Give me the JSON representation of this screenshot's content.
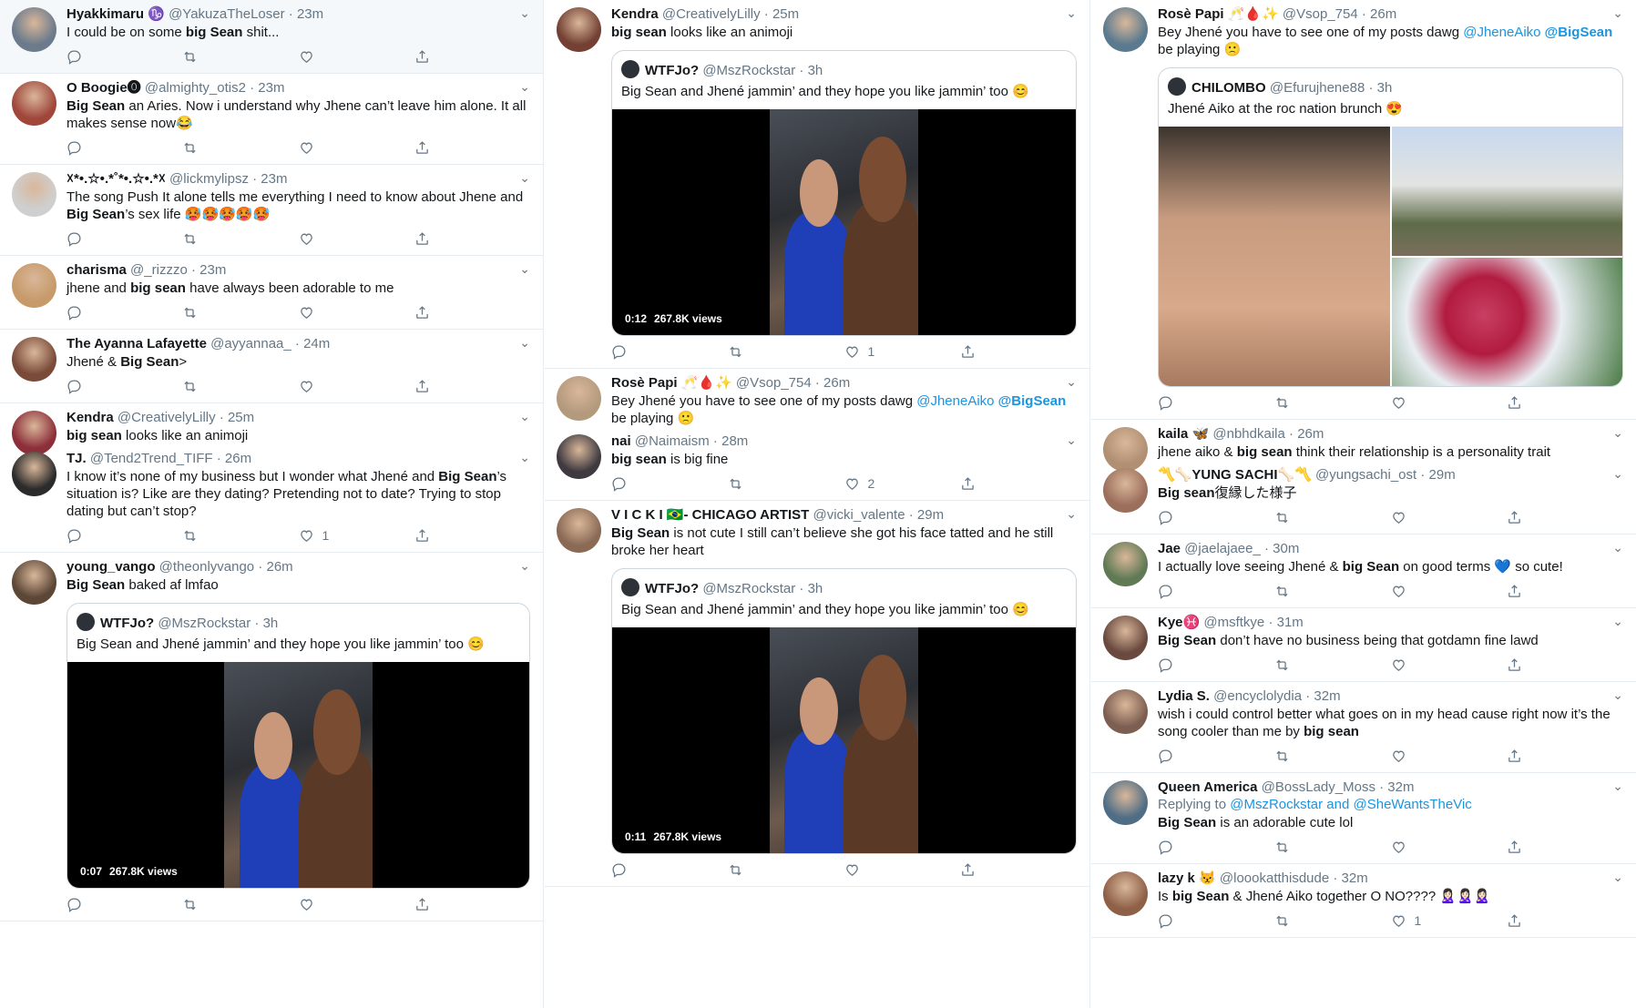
{
  "col1": [
    {
      "name": "Hyakkimaru ♑",
      "handle": "@YakuzaTheLoser",
      "time": "23m",
      "text": [
        [
          "I could be on some ",
          false
        ],
        [
          "big Sean",
          true
        ],
        [
          " shit...",
          false
        ]
      ],
      "likes": ""
    },
    {
      "name": "O Boogie⓿",
      "handle": "@almighty_otis2",
      "time": "23m",
      "text": [
        [
          "Big Sean",
          true
        ],
        [
          " an Aries. Now i understand why Jhene can’t leave him alone. It all makes sense now😂",
          false
        ]
      ],
      "likes": ""
    },
    {
      "name": "☓*•.☆•.*˚*•.☆•.*☓",
      "handle": "@lickmylipsz",
      "time": "23m",
      "text": [
        [
          "The song Push It alone tells me everything I need to know about Jhene and ",
          false
        ],
        [
          "Big Sean",
          true
        ],
        [
          "’s sex life 🥵🥵🥵🥵🥵",
          false
        ]
      ],
      "likes": ""
    },
    {
      "name": "charisma",
      "handle": "@_rizzzo",
      "time": "23m",
      "text": [
        [
          "jhene and ",
          false
        ],
        [
          "big sean",
          true
        ],
        [
          " have always been adorable to me",
          false
        ]
      ],
      "likes": ""
    },
    {
      "name": "The Ayanna Lafayette",
      "handle": "@ayyannaa_",
      "time": "24m",
      "text": [
        [
          "Jhené & ",
          false
        ],
        [
          "Big Sean",
          true
        ],
        [
          ">",
          false
        ]
      ],
      "likes": ""
    },
    {
      "name": "Kendra",
      "handle": "@CreativelyLilly",
      "time": "25m",
      "text": [
        [
          "big sean",
          true
        ],
        [
          " looks like an animoji",
          false
        ]
      ],
      "likes": "",
      "compact": true
    },
    {
      "name": "TJ.",
      "handle": "@Tend2Trend_TIFF",
      "time": "26m",
      "text": [
        [
          "I know it’s none of my business but I wonder what Jhené and ",
          false
        ],
        [
          "Big Sean",
          true
        ],
        [
          "’s situation is? Like are they dating? Pretending not to date? Trying to stop dating but can’t stop?",
          false
        ]
      ],
      "likes": "1"
    },
    {
      "name": "young_vango",
      "handle": "@theonlyvango",
      "time": "26m",
      "text": [
        [
          "Big Sean",
          true
        ],
        [
          " baked af lmfao",
          false
        ]
      ],
      "likes": "",
      "quote": {
        "name": "WTFJo?",
        "handle": "@MszRockstar",
        "time": "3h",
        "text": "Big Sean and Jhené jammin’ and they hope you like jammin’ too 😊",
        "video": {
          "time": "0:07",
          "views": "267.8K views"
        }
      }
    }
  ],
  "col2": [
    {
      "name": "Kendra",
      "handle": "@CreativelyLilly",
      "time": "25m",
      "text": [
        [
          "big sean",
          true
        ],
        [
          " looks like an animoji",
          false
        ]
      ],
      "likes": "1",
      "quote": {
        "name": "WTFJo?",
        "handle": "@MszRockstar",
        "time": "3h",
        "text": "Big Sean and Jhené jammin’ and they hope you like jammin’ too 😊",
        "video": {
          "time": "0:12",
          "views": "267.8K views"
        }
      }
    },
    {
      "name": "Rosè Papi 🥂🩸✨",
      "handle": "@Vsop_754",
      "time": "26m",
      "text": [
        [
          "Bey Jhené you have to see one of my posts dawg ",
          false
        ],
        [
          "@JheneAiko",
          false,
          "link"
        ],
        [
          " ",
          false
        ],
        [
          "@BigSean",
          true,
          "link"
        ],
        [
          " be playing 🙁",
          false
        ]
      ],
      "likes": "",
      "compact": true
    },
    {
      "name": "nai",
      "handle": "@Naimaism",
      "time": "28m",
      "text": [
        [
          "big sean",
          true
        ],
        [
          " is big fine",
          false
        ]
      ],
      "likes": "2"
    },
    {
      "name": "V I C K I 🇧🇷- CHICAGO ARTIST",
      "handle": "@vicki_valente",
      "time": "29m",
      "text": [
        [
          "Big Sean",
          true
        ],
        [
          " is not cute I still can’t believe she got his face tatted and he still broke her heart",
          false
        ]
      ],
      "likes": "",
      "quote": {
        "name": "WTFJo?",
        "handle": "@MszRockstar",
        "time": "3h",
        "text": "Big Sean and Jhené jammin’ and they hope you like jammin’ too 😊",
        "video": {
          "time": "0:11",
          "views": "267.8K views"
        }
      }
    }
  ],
  "col3": [
    {
      "name": "Rosè Papi 🥂🩸✨",
      "handle": "@Vsop_754",
      "time": "26m",
      "text": [
        [
          "Bey Jhené you have to see one of my posts dawg ",
          false
        ],
        [
          "@JheneAiko",
          false,
          "link"
        ],
        [
          " ",
          false
        ],
        [
          "@BigSean",
          true,
          "link"
        ],
        [
          " be playing 🙁",
          false
        ]
      ],
      "likes": "",
      "quote": {
        "name": "CHILOMBO",
        "handle": "@Efurujhene88",
        "time": "3h",
        "text": "Jhené Aiko at the roc nation brunch 😍",
        "photos": true
      }
    },
    {
      "name": "kaila 🦋",
      "handle": "@nbhdkaila",
      "time": "26m",
      "text": [
        [
          "jhene aiko & ",
          false
        ],
        [
          "big sean",
          true
        ],
        [
          " think their relationship is a personality trait",
          false
        ]
      ],
      "likes": "",
      "compact": true
    },
    {
      "name": "〽️🦴YUNG SACHI🦴〽️",
      "handle": "@yungsachi_ost",
      "time": "29m",
      "text": [
        [
          "Big sean",
          true
        ],
        [
          "復縁した様子",
          false
        ]
      ],
      "likes": ""
    },
    {
      "name": "Jae",
      "handle": "@jaelajaee_",
      "time": "30m",
      "text": [
        [
          "I actually love seeing Jhené & ",
          false
        ],
        [
          "big Sean",
          true
        ],
        [
          " on good terms 💙 so cute!",
          false
        ]
      ],
      "likes": ""
    },
    {
      "name": "Kye♓",
      "handle": "@msftkye",
      "time": "31m",
      "text": [
        [
          "Big Sean",
          true
        ],
        [
          " don’t have no business being that gotdamn fine lawd",
          false
        ]
      ],
      "likes": ""
    },
    {
      "name": "Lydia S.",
      "handle": "@encyclolydia",
      "time": "32m",
      "text": [
        [
          "wish i could control better what goes on in my head cause right now it’s the song cooler than me by ",
          false
        ],
        [
          "big sean",
          true
        ]
      ],
      "likes": ""
    },
    {
      "name": "Queen America",
      "handle": "@BossLady_Moss",
      "time": "32m",
      "replying": {
        "prefix": "Replying to ",
        "a": "@MszRockstar",
        "mid": " and ",
        "b": "@SheWantsTheVic"
      },
      "text": [
        [
          "Big Sean",
          true
        ],
        [
          " is an adorable cute lol",
          false
        ]
      ],
      "likes": ""
    },
    {
      "name": "lazy k 😾",
      "handle": "@loookatthisdude",
      "time": "32m",
      "text": [
        [
          "Is ",
          false
        ],
        [
          "big Sean",
          true
        ],
        [
          " & Jhené Aiko together O NO???? 🙎🏻‍♀️🙎🏻‍♀️🙎🏻‍♀️",
          false
        ]
      ],
      "likes": "1"
    }
  ],
  "colors": {
    "link": "#1b95e0",
    "muted": "#657786",
    "border": "#e6ecf0"
  },
  "icons": {
    "reply": "reply-icon",
    "retweet": "retweet-icon",
    "like": "like-icon",
    "share": "share-icon",
    "chevron": "chevron-down-icon"
  }
}
